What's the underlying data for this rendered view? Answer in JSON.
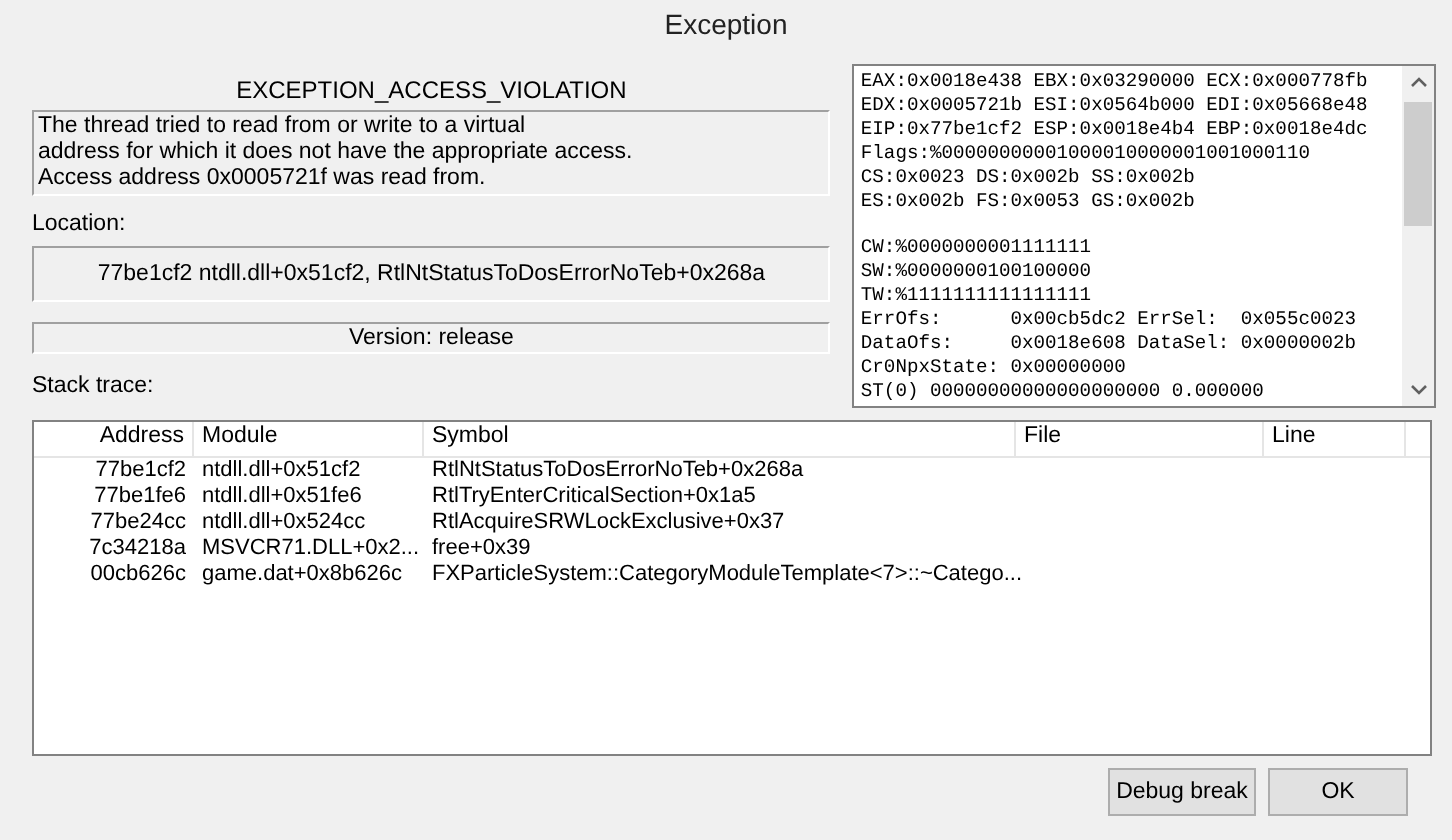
{
  "window": {
    "title": "Exception"
  },
  "exception": {
    "name": "EXCEPTION_ACCESS_VIOLATION",
    "message": [
      "The thread tried to read from or write to a virtual",
      "address for which it does not have the appropriate access.",
      "Access address 0x0005721f was read from."
    ]
  },
  "location": {
    "label": "Location:",
    "value": "77be1cf2 ntdll.dll+0x51cf2, RtlNtStatusToDosErrorNoTeb+0x268a"
  },
  "version": "Version: release",
  "registers": [
    [
      "EAX:0x0018e438 EBX:0x03290000 ECX:0x000778fb",
      "EDX:0x0005721b ESI:0x0564b000 EDI:0x05668e48",
      "EIP:0x77be1cf2 ESP:0x0018e4b4 EBP:0x0018e4dc",
      "Flags:%00000000001000010000001001000110",
      "CS:0x0023 DS:0x002b SS:0x002b",
      "ES:0x002b FS:0x0053 GS:0x002b"
    ],
    [
      "CW:%0000000001111111",
      "SW:%0000000100100000",
      "TW:%1111111111111111",
      "ErrOfs:      0x00cb5dc2 ErrSel:  0x055c0023",
      "DataOfs:     0x0018e608 DataSel: 0x0000002b",
      "Cr0NpxState: 0x00000000",
      "ST(0) 00000000000000000000 0.000000"
    ]
  ],
  "stack_trace": {
    "label": "Stack trace:",
    "columns": [
      "Address",
      "Module",
      "Symbol",
      "File",
      "Line"
    ],
    "rows": [
      {
        "address": "77be1cf2",
        "module": "ntdll.dll+0x51cf2",
        "symbol": "RtlNtStatusToDosErrorNoTeb+0x268a"
      },
      {
        "address": "77be1fe6",
        "module": "ntdll.dll+0x51fe6",
        "symbol": "RtlTryEnterCriticalSection+0x1a5"
      },
      {
        "address": "77be24cc",
        "module": "ntdll.dll+0x524cc",
        "symbol": "RtlAcquireSRWLockExclusive+0x37"
      },
      {
        "address": "7c34218a",
        "module": "MSVCR71.DLL+0x2...",
        "symbol": "free+0x39"
      },
      {
        "address": "00cb626c",
        "module": "game.dat+0x8b626c",
        "symbol": "FXParticleSystem::CategoryModuleTemplate<7>::~Catego..."
      }
    ]
  },
  "buttons": [
    "Debug break",
    "OK"
  ]
}
